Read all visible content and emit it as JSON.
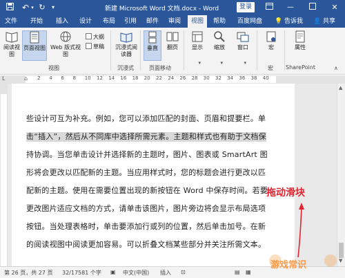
{
  "titlebar": {
    "doc_title": "新建 Microsoft Word 文档.docx - Word",
    "login": "登录"
  },
  "tabs": [
    "文件",
    "开始",
    "插入",
    "设计",
    "布局",
    "引用",
    "邮件",
    "审阅",
    "视图",
    "帮助",
    "百度网盘"
  ],
  "active_tab": "视图",
  "tell_me": "告诉我",
  "share": "共享",
  "ribbon": {
    "read_mode": "阅读视图",
    "print_layout": "页面视图",
    "web_layout": "Web 版式视图",
    "outline": "大纲",
    "draft": "草稿",
    "views_group": "视图",
    "immersive_reader": "沉浸式阅读器",
    "immersive_group": "沉浸式",
    "vertical": "垂直",
    "side_to_side": "翻页",
    "page_movement_group": "页面移动",
    "show": "显示",
    "zoom": "缩放",
    "window": "窗口",
    "macros": "宏",
    "macros_group": "宏",
    "properties": "属性",
    "sharepoint_group": "SharePoint"
  },
  "ruler_numbers": [
    "2",
    "4",
    "6",
    "8",
    "10",
    "12",
    "14",
    "16",
    "18",
    "20",
    "22",
    "24",
    "26",
    "28",
    "30",
    "32",
    "34",
    "36",
    "38",
    "40"
  ],
  "body_lines": [
    "些设计可互为补充。例如，您可以添加匹配的封面、页眉和提要栏。单",
    "击“插入”，然后从不同库中选择所需元素。主题和样式也有助于文档保",
    "持协调。当您单击设计并选择新的主题时，图片、图表或 SmartArt 图",
    "形将会更改以匹配新的主题。当应用样式时，您的标题会进行更改以匹",
    "配新的主题。使用在需要位置出现的新按钮在 Word 中保存时间。若要",
    "更改图片适应文档的方式，请单击该图片，图片旁边将会显示布局选项",
    "按钮。当处理表格时，单击要添加行或列的位置，然后单击加号。在新",
    "的阅读视图中阅读更加容易。可以折叠文档某些部分并关注所需文本。"
  ],
  "annotation": "拖动滑块",
  "watermark": "游戏常识",
  "status": {
    "page": "第 26 页，共 27 页",
    "words": "32/17581 个字",
    "language": "中文(中国)",
    "mode": "插入"
  },
  "colors": {
    "accent": "#2b579a",
    "annotation": "#e0242f",
    "highlight": "#d9d9d9"
  }
}
